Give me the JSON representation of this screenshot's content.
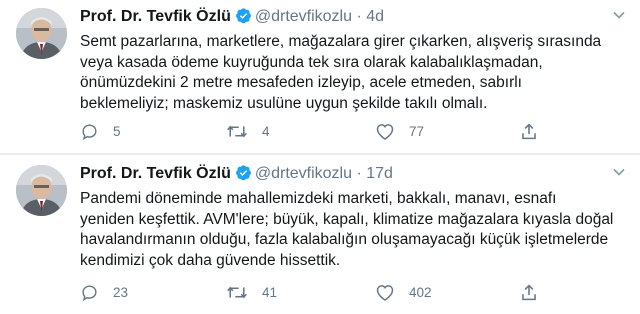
{
  "tweets": [
    {
      "name": "Prof. Dr. Tevfik Özlü",
      "handle": "@drtevfikozlu",
      "separator": "·",
      "time": "4d",
      "text": "Semt pazarlarına, marketlere, mağazalara girer çıkarken, alışveriş sırasında\nveya kasada ödeme kuyruğunda tek sıra olarak kalabalıklaşmadan,\nönümüzdekini 2 metre mesafeden izleyip, acele etmeden, sabırlı\nbeklemeliyiz; maskemiz usulüne uygun şekilde takılı olmalı.",
      "replies": "5",
      "retweets": "4",
      "likes": "77"
    },
    {
      "name": "Prof. Dr. Tevfik Özlü",
      "handle": "@drtevfikozlu",
      "separator": "·",
      "time": "17d",
      "text": "Pandemi döneminde mahallemizdeki marketi, bakkalı, manavı, esnafı\nyeniden keşfettik. AVM'lere; büyük, kapalı, klimatize mağazalara kıyasla doğal\nhavalandırmanın olduğu, fazla kalabalığın oluşamayacağı küçük  işletmelerde\nkendimizi çok daha güvende hissettik.",
      "replies": "23",
      "retweets": "41",
      "likes": "402"
    }
  ],
  "colors": {
    "verified": "#1da1f2",
    "muted": "#657786",
    "text": "#14171a"
  },
  "icons": [
    "avatar",
    "verified-badge-icon",
    "chevron-down-icon",
    "reply-icon",
    "retweet-icon",
    "like-icon",
    "share-icon"
  ]
}
